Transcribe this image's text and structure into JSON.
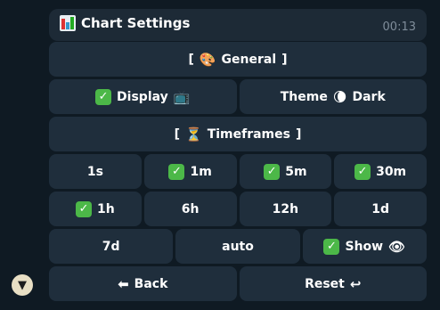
{
  "header": {
    "icon": "bar-chart-icon",
    "title": "Chart Settings",
    "time": "00:13"
  },
  "keyboard": {
    "rows": [
      [
        {
          "name": "section-general",
          "pre": "[",
          "emoji": "🎨",
          "label": "General",
          "post": "]"
        }
      ],
      [
        {
          "name": "display-button",
          "check": "✓",
          "label": "Display",
          "emoji": "📺"
        },
        {
          "name": "theme-button",
          "label": "Theme",
          "emoji": "🌘",
          "label2": "Dark"
        }
      ],
      [
        {
          "name": "section-timeframes",
          "pre": "[",
          "emoji": "⏳",
          "label": "Timeframes",
          "post": "]"
        }
      ],
      [
        {
          "name": "tf-1s",
          "label": "1s"
        },
        {
          "name": "tf-1m",
          "check": "✓",
          "label": "1m"
        },
        {
          "name": "tf-5m",
          "check": "✓",
          "label": "5m"
        },
        {
          "name": "tf-30m",
          "check": "✓",
          "label": "30m"
        }
      ],
      [
        {
          "name": "tf-1h",
          "check": "✓",
          "label": "1h"
        },
        {
          "name": "tf-6h",
          "label": "6h"
        },
        {
          "name": "tf-12h",
          "label": "12h"
        },
        {
          "name": "tf-1d",
          "label": "1d"
        }
      ],
      [
        {
          "name": "tf-7d",
          "label": "7d"
        },
        {
          "name": "tf-auto",
          "label": "auto"
        },
        {
          "name": "show-button",
          "check": "✓",
          "label": "Show",
          "emoji": "👁"
        }
      ],
      [
        {
          "name": "back-button",
          "emoji": "⬅",
          "label": "Back"
        },
        {
          "name": "reset-button",
          "label": "Reset",
          "emoji": "↩"
        }
      ]
    ]
  },
  "colors": {
    "background": "#0f1a23",
    "button": "#1f2e3c",
    "check": "#4cb848"
  }
}
